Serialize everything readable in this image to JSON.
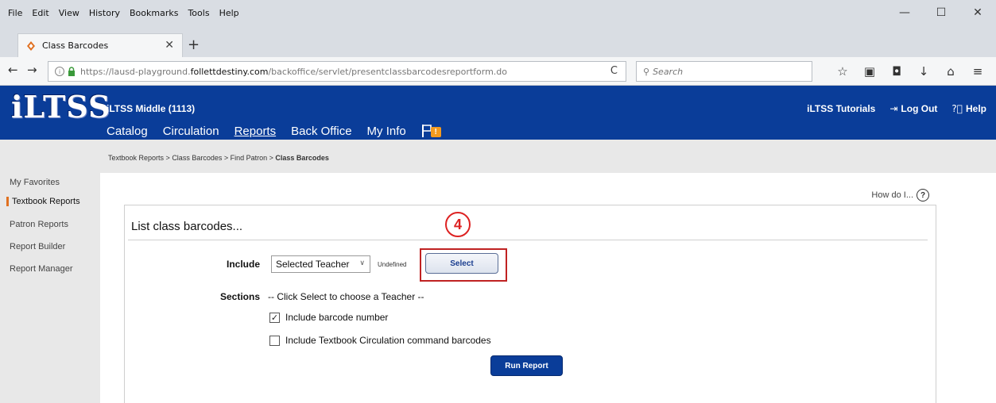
{
  "browser": {
    "menu": [
      "File",
      "Edit",
      "View",
      "History",
      "Bookmarks",
      "Tools",
      "Help"
    ],
    "window_controls": {
      "minimize": "—",
      "maximize": "☐",
      "close": "✕"
    },
    "tab": {
      "title": "Class Barcodes",
      "close": "✕",
      "new_tab": "+"
    },
    "nav": {
      "back": "←",
      "forward": "→"
    },
    "url": {
      "prefix": "https://lausd-playground.",
      "domain": "follettdestiny.com",
      "path": "/backoffice/servlet/presentclassbarcodesreportform.do",
      "reload": "C"
    },
    "search": {
      "placeholder": "Search"
    },
    "toolbar_icons": [
      "☆",
      "▣",
      "◘",
      "↓",
      "⌂",
      "≡"
    ]
  },
  "header": {
    "logo": "iLTSS",
    "site_name": "iLTSS Middle (1113)",
    "nav": [
      {
        "label": "Catalog"
      },
      {
        "label": "Circulation"
      },
      {
        "label": "Reports"
      },
      {
        "label": "Back Office"
      },
      {
        "label": "My Info"
      }
    ],
    "active_nav": "Reports",
    "flag_badge": "!",
    "right_links": {
      "tutorials": "iLTSS Tutorials",
      "logout": "Log Out",
      "help": "Help"
    },
    "brand_color": "#0a3d99"
  },
  "breadcrumb": {
    "items": [
      "Textbook Reports",
      "Class Barcodes",
      "Find Patron"
    ],
    "separator": " > ",
    "current": "Class Barcodes"
  },
  "sidebar": {
    "items": [
      {
        "label": "My Favorites"
      },
      {
        "label": "Textbook Reports"
      },
      {
        "label": "Patron Reports"
      },
      {
        "label": "Report Builder"
      },
      {
        "label": "Report Manager"
      }
    ],
    "active": "Textbook Reports",
    "accent_color": "#e07020"
  },
  "content": {
    "how_do_i": "How do I...",
    "panel_title": "List class barcodes...",
    "step_badge": "4",
    "include_label": "Include",
    "include_selected": "Selected Teacher",
    "undefined_text": "Undefined",
    "select_button": "Select",
    "sections_label": "Sections",
    "sections_hint": "-- Click Select to choose a Teacher --",
    "checkbox_barcode": {
      "label": "Include barcode number",
      "checked": true
    },
    "checkbox_circulation": {
      "label": "Include Textbook Circulation command barcodes",
      "checked": false
    },
    "run_button": "Run Report",
    "highlight_color": "#c02222"
  }
}
